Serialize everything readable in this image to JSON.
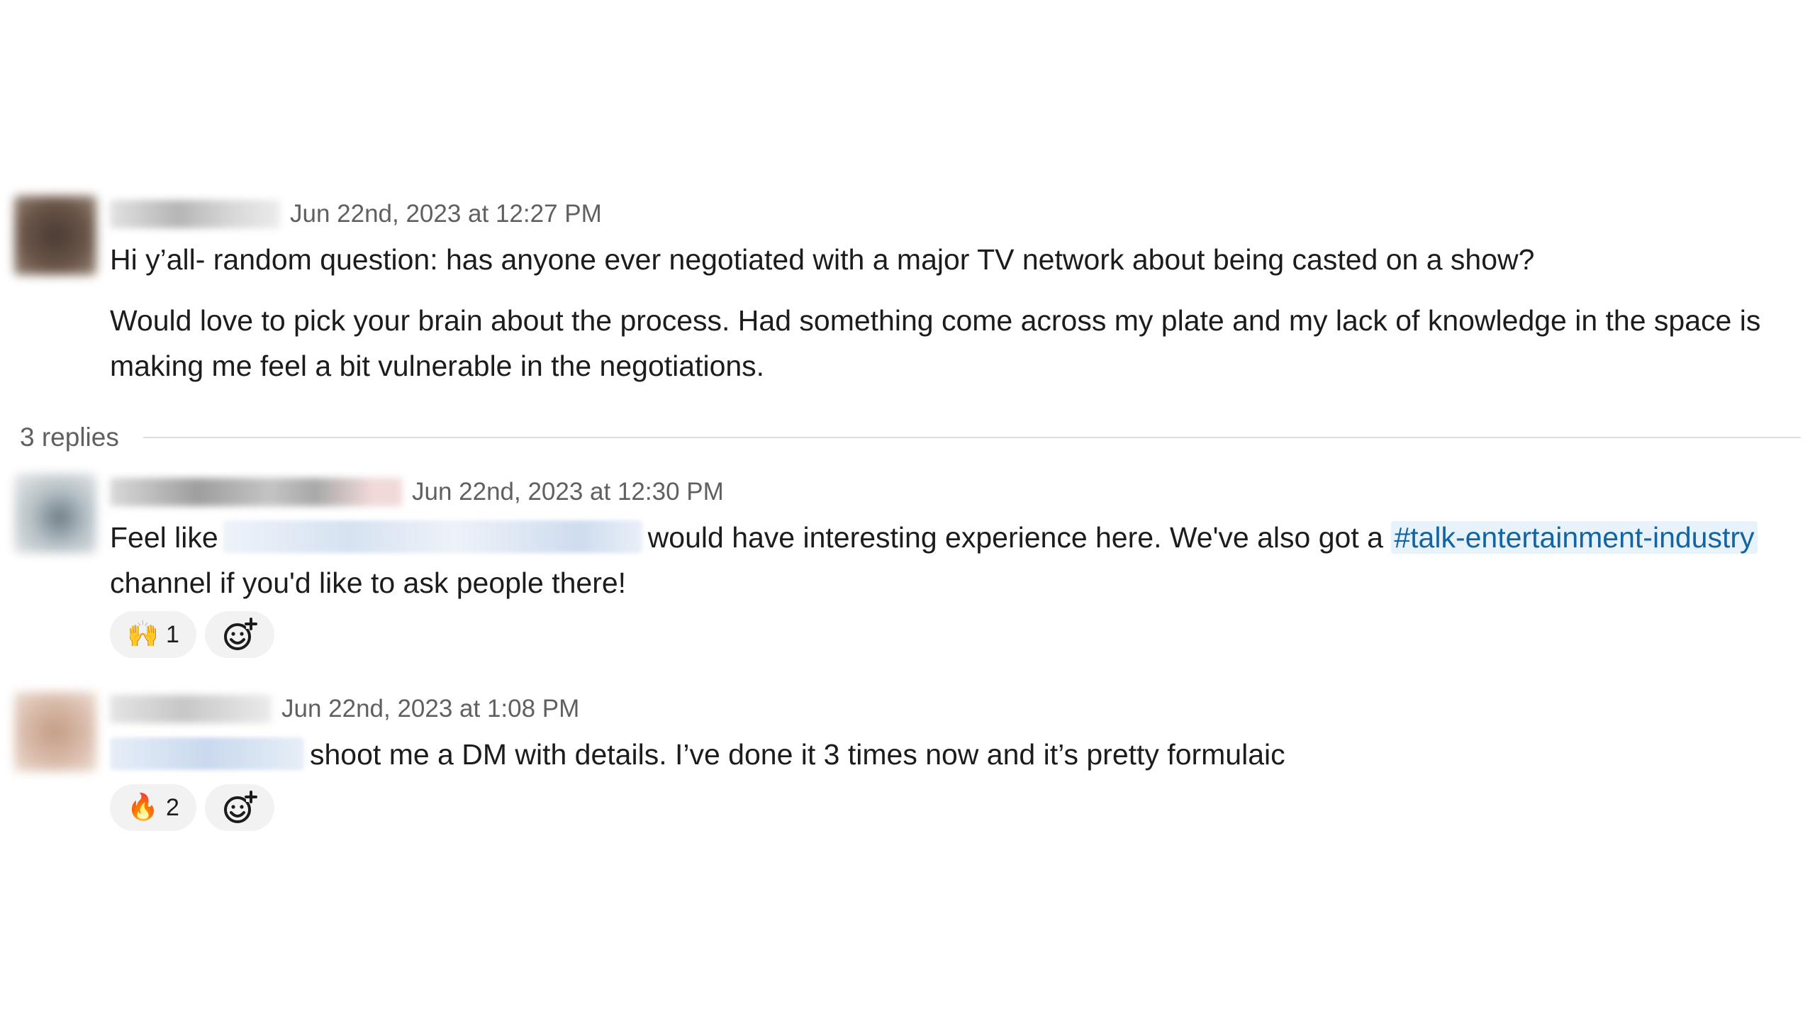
{
  "messages": [
    {
      "timestamp": "Jun 22nd, 2023 at 12:27 PM",
      "paragraphs": [
        "Hi y’all- random question: has anyone ever negotiated with a major TV network about being casted on a show?",
        "Would love to pick your brain about the process. Had something come across my plate and my lack of knowledge in the space is making me feel a bit vulnerable in the negotiations."
      ]
    },
    {
      "timestamp": "Jun 22nd, 2023 at 12:30 PM",
      "text_before": "Feel like",
      "text_after": "would have interesting experience here. We've also got a",
      "channel": "#talk-entertainment-industry",
      "text_end": "channel if you'd like to ask people there!",
      "reaction": {
        "emoji": "🙌",
        "count": "1"
      }
    },
    {
      "timestamp": "Jun 22nd, 2023 at 1:08 PM",
      "text_after": "shoot me a DM with details. I’ve done it 3 times now and it’s pretty formulaic",
      "reaction": {
        "emoji": "🔥",
        "count": "2"
      }
    }
  ],
  "thread": {
    "replies_label": "3 replies"
  },
  "icons": {
    "add_reaction": "add-reaction-icon"
  }
}
